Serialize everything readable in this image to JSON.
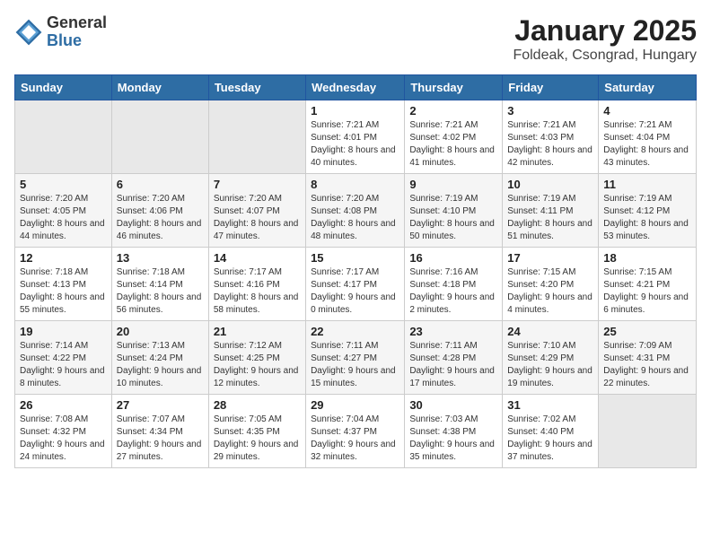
{
  "header": {
    "logo_general": "General",
    "logo_blue": "Blue",
    "month": "January 2025",
    "location": "Foldeak, Csongrad, Hungary"
  },
  "weekdays": [
    "Sunday",
    "Monday",
    "Tuesday",
    "Wednesday",
    "Thursday",
    "Friday",
    "Saturday"
  ],
  "weeks": [
    [
      {
        "day": "",
        "info": ""
      },
      {
        "day": "",
        "info": ""
      },
      {
        "day": "",
        "info": ""
      },
      {
        "day": "1",
        "info": "Sunrise: 7:21 AM\nSunset: 4:01 PM\nDaylight: 8 hours and 40 minutes."
      },
      {
        "day": "2",
        "info": "Sunrise: 7:21 AM\nSunset: 4:02 PM\nDaylight: 8 hours and 41 minutes."
      },
      {
        "day": "3",
        "info": "Sunrise: 7:21 AM\nSunset: 4:03 PM\nDaylight: 8 hours and 42 minutes."
      },
      {
        "day": "4",
        "info": "Sunrise: 7:21 AM\nSunset: 4:04 PM\nDaylight: 8 hours and 43 minutes."
      }
    ],
    [
      {
        "day": "5",
        "info": "Sunrise: 7:20 AM\nSunset: 4:05 PM\nDaylight: 8 hours and 44 minutes."
      },
      {
        "day": "6",
        "info": "Sunrise: 7:20 AM\nSunset: 4:06 PM\nDaylight: 8 hours and 46 minutes."
      },
      {
        "day": "7",
        "info": "Sunrise: 7:20 AM\nSunset: 4:07 PM\nDaylight: 8 hours and 47 minutes."
      },
      {
        "day": "8",
        "info": "Sunrise: 7:20 AM\nSunset: 4:08 PM\nDaylight: 8 hours and 48 minutes."
      },
      {
        "day": "9",
        "info": "Sunrise: 7:19 AM\nSunset: 4:10 PM\nDaylight: 8 hours and 50 minutes."
      },
      {
        "day": "10",
        "info": "Sunrise: 7:19 AM\nSunset: 4:11 PM\nDaylight: 8 hours and 51 minutes."
      },
      {
        "day": "11",
        "info": "Sunrise: 7:19 AM\nSunset: 4:12 PM\nDaylight: 8 hours and 53 minutes."
      }
    ],
    [
      {
        "day": "12",
        "info": "Sunrise: 7:18 AM\nSunset: 4:13 PM\nDaylight: 8 hours and 55 minutes."
      },
      {
        "day": "13",
        "info": "Sunrise: 7:18 AM\nSunset: 4:14 PM\nDaylight: 8 hours and 56 minutes."
      },
      {
        "day": "14",
        "info": "Sunrise: 7:17 AM\nSunset: 4:16 PM\nDaylight: 8 hours and 58 minutes."
      },
      {
        "day": "15",
        "info": "Sunrise: 7:17 AM\nSunset: 4:17 PM\nDaylight: 9 hours and 0 minutes."
      },
      {
        "day": "16",
        "info": "Sunrise: 7:16 AM\nSunset: 4:18 PM\nDaylight: 9 hours and 2 minutes."
      },
      {
        "day": "17",
        "info": "Sunrise: 7:15 AM\nSunset: 4:20 PM\nDaylight: 9 hours and 4 minutes."
      },
      {
        "day": "18",
        "info": "Sunrise: 7:15 AM\nSunset: 4:21 PM\nDaylight: 9 hours and 6 minutes."
      }
    ],
    [
      {
        "day": "19",
        "info": "Sunrise: 7:14 AM\nSunset: 4:22 PM\nDaylight: 9 hours and 8 minutes."
      },
      {
        "day": "20",
        "info": "Sunrise: 7:13 AM\nSunset: 4:24 PM\nDaylight: 9 hours and 10 minutes."
      },
      {
        "day": "21",
        "info": "Sunrise: 7:12 AM\nSunset: 4:25 PM\nDaylight: 9 hours and 12 minutes."
      },
      {
        "day": "22",
        "info": "Sunrise: 7:11 AM\nSunset: 4:27 PM\nDaylight: 9 hours and 15 minutes."
      },
      {
        "day": "23",
        "info": "Sunrise: 7:11 AM\nSunset: 4:28 PM\nDaylight: 9 hours and 17 minutes."
      },
      {
        "day": "24",
        "info": "Sunrise: 7:10 AM\nSunset: 4:29 PM\nDaylight: 9 hours and 19 minutes."
      },
      {
        "day": "25",
        "info": "Sunrise: 7:09 AM\nSunset: 4:31 PM\nDaylight: 9 hours and 22 minutes."
      }
    ],
    [
      {
        "day": "26",
        "info": "Sunrise: 7:08 AM\nSunset: 4:32 PM\nDaylight: 9 hours and 24 minutes."
      },
      {
        "day": "27",
        "info": "Sunrise: 7:07 AM\nSunset: 4:34 PM\nDaylight: 9 hours and 27 minutes."
      },
      {
        "day": "28",
        "info": "Sunrise: 7:05 AM\nSunset: 4:35 PM\nDaylight: 9 hours and 29 minutes."
      },
      {
        "day": "29",
        "info": "Sunrise: 7:04 AM\nSunset: 4:37 PM\nDaylight: 9 hours and 32 minutes."
      },
      {
        "day": "30",
        "info": "Sunrise: 7:03 AM\nSunset: 4:38 PM\nDaylight: 9 hours and 35 minutes."
      },
      {
        "day": "31",
        "info": "Sunrise: 7:02 AM\nSunset: 4:40 PM\nDaylight: 9 hours and 37 minutes."
      },
      {
        "day": "",
        "info": ""
      }
    ]
  ]
}
